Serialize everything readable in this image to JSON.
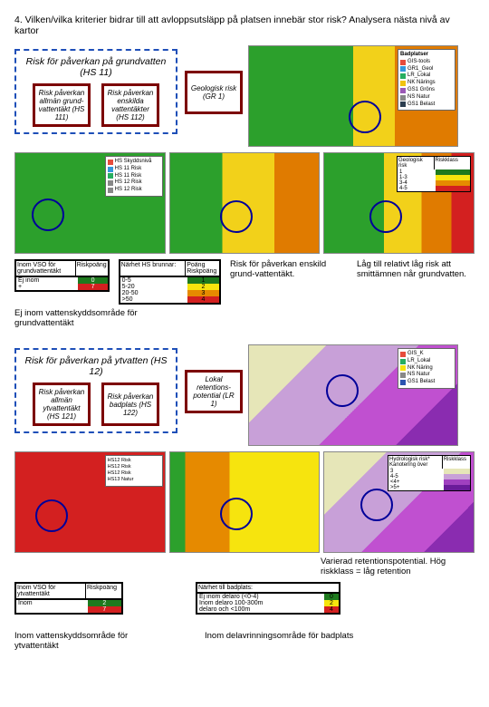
{
  "heading": "4. Vilken/vilka kriterier bidrar till att avloppsutsläpp på platsen innebär stor risk? Analysera nästa nivå av kartor",
  "group1": {
    "title": "Risk för påverkan på grundvatten (HS 11)",
    "nodes": {
      "a": "Risk påverkan allmän grund-vattentäkt (HS 111)",
      "b": "Risk påverkan enskilda vattentäkter (HS 112)",
      "c": "Geologisk risk (GR 1)"
    }
  },
  "legend_g1": {
    "title": "Badplatser",
    "items": [
      {
        "label": "GIS-tools",
        "color": "#e74c3c"
      },
      {
        "label": "GR1_Geol",
        "color": "#3498db"
      },
      {
        "label": "LR_Lokal",
        "color": "#27ae60"
      },
      {
        "label": "NK Närings",
        "color": "#f1c40f"
      },
      {
        "label": "GS1 Gröns",
        "color": "#9b59b6"
      },
      {
        "label": "NS Natur",
        "color": "#888888"
      },
      {
        "label": "GS1 Belast",
        "color": "#2c3e50"
      }
    ]
  },
  "legend_g1_left": [
    "HS Skyddsnivå",
    "HS 11 Risk",
    "HS 11 Risk",
    "HS 12 Risk",
    "HS 12 Risk"
  ],
  "table_risk": {
    "h1": "Geologisk risk",
    "h2": "Riskklass",
    "rows": [
      {
        "lab": "1",
        "col": "#1e7a1e"
      },
      {
        "lab": "1-3",
        "col": "#f6e40e"
      },
      {
        "lab": "3-4",
        "col": "#e68a00"
      },
      {
        "lab": "4-5",
        "col": "#d32020"
      }
    ]
  },
  "table_vso": {
    "title": "Inom VSO för grundvattentäkt",
    "h2": "Riskpoäng",
    "rows": [
      {
        "lab": "Ej inom",
        "col": "#1e7a1e",
        "val": "0"
      },
      {
        "lab": "+",
        "col": "#d32020",
        "val": "7"
      }
    ]
  },
  "table_hs112": {
    "title": "Närhet HS brunnar:",
    "h2": "Poäng Riskpoäng",
    "rows": [
      {
        "lab": "0-5",
        "col": "#1e7a1e",
        "val": "1"
      },
      {
        "lab": "5-20",
        "col": "#f6e40e",
        "val": "2"
      },
      {
        "lab": "20-50",
        "col": "#e68a00",
        "val": "3"
      },
      {
        "lab": ">50",
        "col": "#d32020",
        "val": "4"
      }
    ]
  },
  "comment_risk1": "Risk för påverkan enskild grund-vattentäkt.",
  "comment_risk2": "Låg till relativt låg risk att smittämnen når grundvatten.",
  "caption1": "Ej inom vattenskyddsområde för grundvattentäkt",
  "group2": {
    "title": "Risk för påverkan på ytvatten (HS 12)",
    "nodes": {
      "a": "Risk påverkan allmän ytvattentäkt (HS 121)",
      "b": "Risk påverkan badplats (HS 122)",
      "c": "Lokal retentions-potential (LR 1)"
    }
  },
  "table_yt": {
    "title": "Inom VSO för ytvattentäkt",
    "h2": "Riskpoäng",
    "rows": [
      {
        "lab": "Inom",
        "col": "#1e7a1e",
        "val": "2"
      },
      {
        "lab": "",
        "col": "#d32020",
        "val": "7"
      }
    ]
  },
  "table_bad": {
    "title": "Närhet till badplats:",
    "rows": [
      {
        "lab": "Ej inom delaro (<0-4)",
        "col": "#1e7a1e",
        "val": "0"
      },
      {
        "lab": "Inom delaro 100-300m",
        "col": "#f6e40e",
        "val": "2"
      },
      {
        "lab": "delaro och <100m",
        "col": "#d32020",
        "val": "4"
      }
    ]
  },
  "table_ret": {
    "h1": "Hydrologisk risk* Kanotering över",
    "h2": "Riskklass",
    "rows": [
      {
        "lab": "3",
        "col": "#e6e6b8"
      },
      {
        "lab": "4-5",
        "col": "#c8a0d8"
      },
      {
        "lab": "<4+",
        "col": "#a040c0"
      },
      {
        "lab": ">5+",
        "col": "#6a1b9a"
      }
    ]
  },
  "comment_ret": "Varierad retentionspotential. Hög riskklass = låg retention",
  "caption2a": "Inom vattenskyddsområde för ytvattentäkt",
  "caption2b": "Inom delavrinningsområde för badplats"
}
